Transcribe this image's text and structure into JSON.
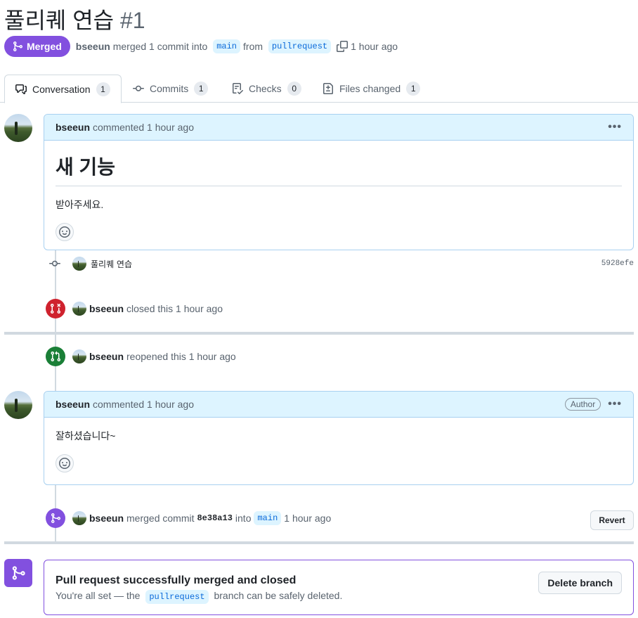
{
  "pr": {
    "title": "풀리퀘 연습",
    "number": "#1",
    "state_label": "Merged",
    "author": "bseeun",
    "merge_text": "merged 1 commit into",
    "base_branch": "main",
    "from_text": "from",
    "head_branch": "pullrequest",
    "time": "1 hour ago"
  },
  "tabs": [
    {
      "label": "Conversation",
      "count": "1"
    },
    {
      "label": "Commits",
      "count": "1"
    },
    {
      "label": "Checks",
      "count": "0"
    },
    {
      "label": "Files changed",
      "count": "1"
    }
  ],
  "comment1": {
    "author": "bseeun",
    "meta": "commented 1 hour ago",
    "heading": "새 기능",
    "body": "받아주세요."
  },
  "commit": {
    "message": "풀리퀘 연습",
    "sha": "5928efe"
  },
  "closed_event": {
    "author": "bseeun",
    "text": "closed this 1 hour ago"
  },
  "reopened_event": {
    "author": "bseeun",
    "text": "reopened this 1 hour ago"
  },
  "comment2": {
    "author": "bseeun",
    "meta": "commented 1 hour ago",
    "badge": "Author",
    "body": "잘하셨습니다~"
  },
  "merged_event": {
    "author": "bseeun",
    "text": "merged commit",
    "sha": "8e38a13",
    "into": "into",
    "branch": "main",
    "time": "1 hour ago",
    "revert_label": "Revert"
  },
  "merge_box": {
    "title": "Pull request successfully merged and closed",
    "sub_before": "You're all set — the",
    "branch": "pullrequest",
    "sub_after": "branch can be safely deleted.",
    "delete_label": "Delete branch"
  },
  "colors": {
    "merged": "#8250df",
    "closed": "#cf222e",
    "open": "#1a7f37",
    "link": "#0969da"
  }
}
